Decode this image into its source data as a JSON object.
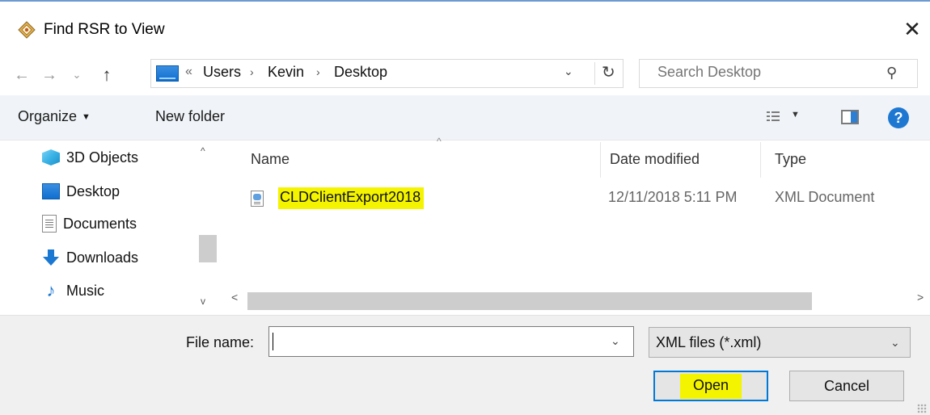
{
  "window": {
    "title": "Find RSR to View",
    "close_glyph": "✕"
  },
  "nav": {
    "back_glyph": "←",
    "forward_glyph": "→",
    "recent_glyph": "⌄",
    "up_glyph": "↑"
  },
  "address": {
    "overflow": "«",
    "crumbs": [
      "Users",
      "Kevin",
      "Desktop"
    ],
    "separator": "›",
    "dropdown_glyph": "⌄",
    "refresh_glyph": "↻"
  },
  "search": {
    "placeholder": "Search Desktop",
    "icon": "search-icon",
    "icon_glyph": "⚲"
  },
  "toolbar": {
    "organize_label": "Organize",
    "organize_caret": "▼",
    "new_folder_label": "New folder",
    "view_caret": "▼",
    "help_glyph": "?"
  },
  "sidebar": {
    "items": [
      {
        "label": "3D Objects",
        "icon": "3d-objects-icon"
      },
      {
        "label": "Desktop",
        "icon": "desktop-icon"
      },
      {
        "label": "Documents",
        "icon": "documents-icon"
      },
      {
        "label": "Downloads",
        "icon": "downloads-icon"
      },
      {
        "label": "Music",
        "icon": "music-icon",
        "glyph": "♪"
      }
    ],
    "scroll_up_glyph": "^",
    "scroll_down_glyph": "v"
  },
  "filelist": {
    "sort_glyph": "^",
    "columns": [
      "Name",
      "Date modified",
      "Type"
    ],
    "rows": [
      {
        "name": "CLDClientExport2018",
        "date": "12/11/2018 5:11 PM",
        "type": "XML Document",
        "highlighted": true
      }
    ],
    "hscroll_left_glyph": "<",
    "hscroll_right_glyph": ">"
  },
  "footer": {
    "filename_label": "File name:",
    "filename_value": "",
    "filename_dropdown_glyph": "⌄",
    "filetype_selected": "XML files (*.xml)",
    "filetype_caret": "⌄",
    "open_label": "Open",
    "cancel_label": "Cancel"
  },
  "colors": {
    "accent": "#0078d7",
    "highlight": "#f4f400",
    "toolbar_bg": "#f0f4f8",
    "footer_bg": "#f0f0f0"
  }
}
